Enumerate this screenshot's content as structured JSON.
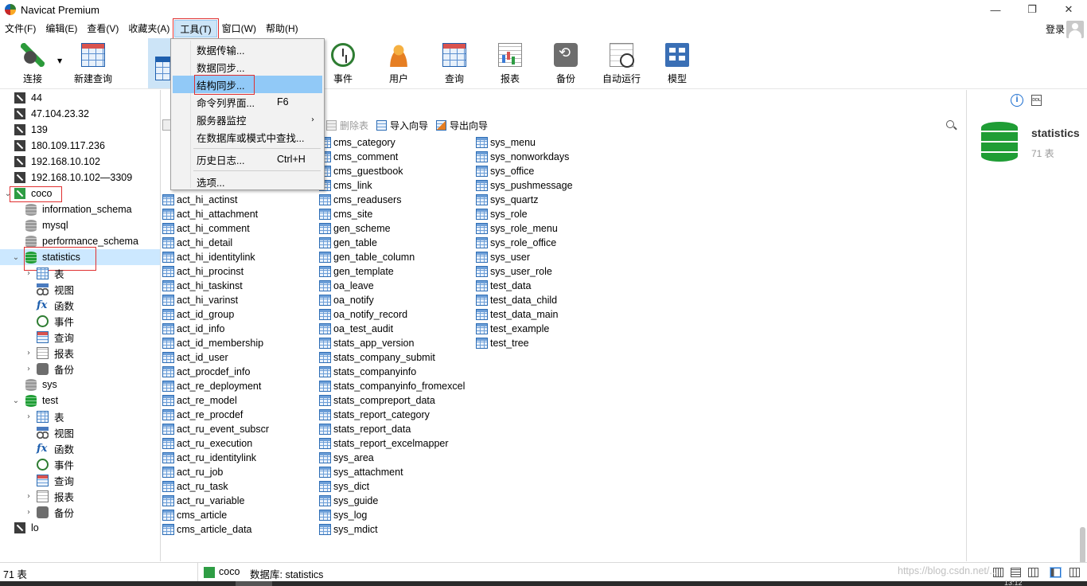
{
  "window": {
    "title": "Navicat Premium",
    "controls": {
      "minimize": "—",
      "maximize": "❐",
      "close": "✕"
    }
  },
  "menubar": {
    "items": [
      {
        "label": "文件(F)"
      },
      {
        "label": "编辑(E)"
      },
      {
        "label": "查看(V)"
      },
      {
        "label": "收藏夹(A)"
      },
      {
        "label": "工具(T)",
        "active": true
      },
      {
        "label": "窗口(W)"
      },
      {
        "label": "帮助(H)"
      }
    ],
    "login": "登录"
  },
  "toolbar": {
    "connect": "连接",
    "new_query": "新建查询",
    "event": "事件",
    "user": "用户",
    "query": "查询",
    "report": "报表",
    "backup": "备份",
    "auto_run": "自动运行",
    "model": "模型"
  },
  "tools_menu": {
    "items": [
      {
        "label": "数据传输..."
      },
      {
        "label": "数据同步..."
      },
      {
        "label": "结构同步...",
        "highlighted": true
      },
      {
        "label": "命令列界面...",
        "shortcut": "F6"
      },
      {
        "label": "服务器监控",
        "submenu": true
      },
      {
        "label": "在数据库或模式中查找..."
      },
      {
        "label": "历史日志...",
        "shortcut": "Ctrl+H"
      },
      {
        "label": "选项..."
      }
    ]
  },
  "navigator": {
    "connections_top": [
      "44",
      "47.104.23.32",
      "139",
      "180.109.117.236",
      "192.168.10.102",
      "192.168.10.102—3309"
    ],
    "coco": {
      "label": "coco",
      "databases": [
        "information_schema",
        "mysql",
        "performance_schema"
      ],
      "statistics": {
        "label": "statistics",
        "children": [
          "表",
          "视图",
          "函数",
          "事件",
          "查询",
          "报表",
          "备份"
        ]
      },
      "sys": "sys",
      "test": {
        "label": "test",
        "children": [
          "表",
          "视图",
          "函数",
          "事件",
          "查询",
          "报表",
          "备份"
        ]
      }
    },
    "connections_bottom": [
      "lo"
    ]
  },
  "object_toolbar": {
    "delete_table": "删除表",
    "import_wizard": "导入向导",
    "export_wizard": "导出向导"
  },
  "tables": {
    "col1": [
      "",
      "",
      "",
      "",
      "act_hi_actinst",
      "act_hi_attachment",
      "act_hi_comment",
      "act_hi_detail",
      "act_hi_identitylink",
      "act_hi_procinst",
      "act_hi_taskinst",
      "act_hi_varinst",
      "act_id_group",
      "act_id_info",
      "act_id_membership",
      "act_id_user",
      "act_procdef_info",
      "act_re_deployment",
      "act_re_model",
      "act_re_procdef",
      "act_ru_event_subscr",
      "act_ru_execution",
      "act_ru_identitylink",
      "act_ru_job",
      "act_ru_task",
      "act_ru_variable",
      "cms_article",
      "cms_article_data"
    ],
    "col2": [
      "cms_category",
      "cms_comment",
      "cms_guestbook",
      "cms_link",
      "cms_readusers",
      "cms_site",
      "gen_scheme",
      "gen_table",
      "gen_table_column",
      "gen_template",
      "oa_leave",
      "oa_notify",
      "oa_notify_record",
      "oa_test_audit",
      "stats_app_version",
      "stats_company_submit",
      "stats_companyinfo",
      "stats_companyinfo_fromexcel",
      "stats_compreport_data",
      "stats_report_category",
      "stats_report_data",
      "stats_report_excelmapper",
      "sys_area",
      "sys_attachment",
      "sys_dict",
      "sys_guide",
      "sys_log",
      "sys_mdict"
    ],
    "col3": [
      "sys_menu",
      "sys_nonworkdays",
      "sys_office",
      "sys_pushmessage",
      "sys_quartz",
      "sys_role",
      "sys_role_menu",
      "sys_role_office",
      "sys_user",
      "sys_user_role",
      "test_data",
      "test_data_child",
      "test_data_main",
      "test_example",
      "test_tree"
    ]
  },
  "info_panel": {
    "name": "statistics",
    "count": "71 表",
    "ddl_label": "DDL"
  },
  "statusbar": {
    "count": "71 表",
    "connection": "coco",
    "database": "数据库: statistics"
  },
  "watermark": "https://blog.csdn.net/...",
  "taskbar_clock": "13:12"
}
